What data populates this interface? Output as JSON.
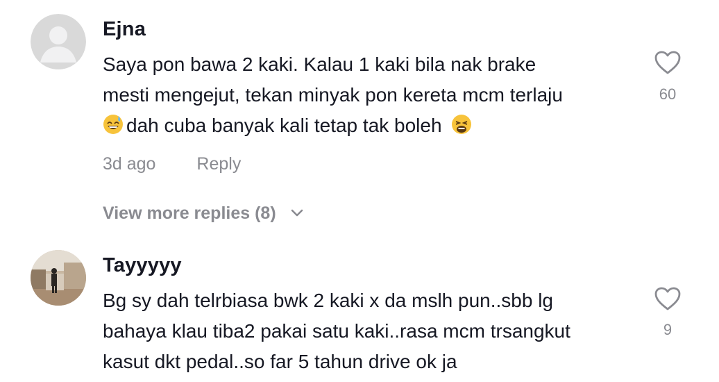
{
  "comments": [
    {
      "username": "Ejna",
      "lines": [
        "Saya pon bawa 2 kaki. Kalau 1 kaki bila nak brake",
        "mesti mengejut, tekan minyak pon kereta mcm terlaju",
        "dah cuba banyak kali tetap tak boleh"
      ],
      "emojis": [
        "grinning-sweat-emoji",
        "weary-face-emoji"
      ],
      "time": "3d ago",
      "reply_label": "Reply",
      "view_more": "View more replies (8)",
      "like_count": "60",
      "avatar": "default-avatar-icon"
    },
    {
      "username": "Tayyyyy",
      "lines": [
        "Bg sy dah telrbiasa bwk 2 kaki x da mslh pun..sbb lg",
        "bahaya klau tiba2 pakai satu kaki..rasa mcm trsangkut",
        "kasut dkt pedal..so far 5 tahun drive ok ja"
      ],
      "like_count": "9",
      "avatar": "photo-avatar"
    }
  ],
  "colors": {
    "text": "#161823",
    "secondary": "#8a8b91",
    "icon": "#8a8b91"
  },
  "icons": {
    "like": "heart-outline-icon",
    "expand": "chevron-down-icon"
  }
}
